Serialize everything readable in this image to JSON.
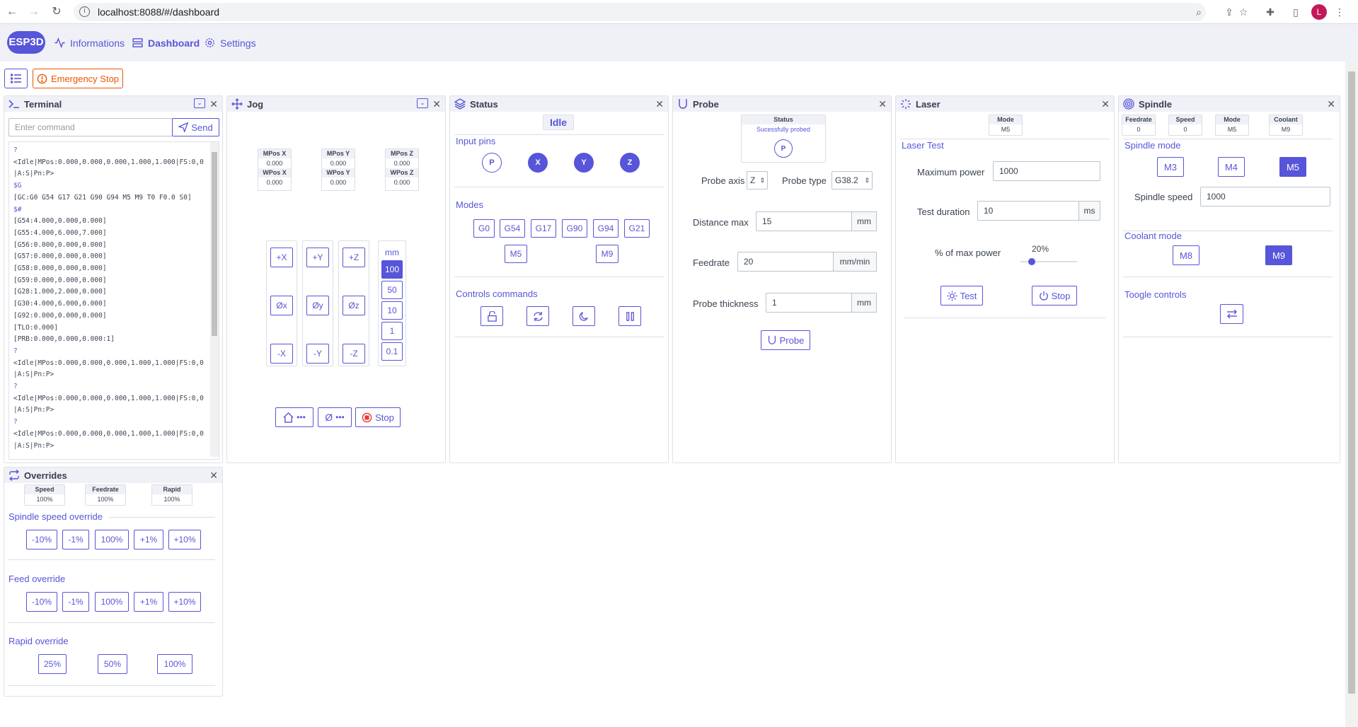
{
  "browser": {
    "url": "localhost:8088/#/dashboard",
    "avatar": "L"
  },
  "nav": {
    "logo": "ESP3D",
    "informations": "Informations",
    "dashboard": "Dashboard",
    "settings": "Settings"
  },
  "toolbar": {
    "emergency": "Emergency Stop"
  },
  "terminal": {
    "title": "Terminal",
    "placeholder": "Enter command",
    "send": "Send",
    "lines": [
      {
        "t": "?",
        "c": 1
      },
      {
        "t": "<Idle|MPos:0.000,0.000,0.000,1.000,1.000|FS:0,0|A:S|Pn:P>",
        "c": 0
      },
      {
        "t": "$G",
        "c": 1
      },
      {
        "t": "[GC:G0 G54 G17 G21 G90 G94 M5 M9 T0 F0.0 S0]",
        "c": 0
      },
      {
        "t": "$#",
        "c": 1
      },
      {
        "t": "[G54:4.000,0.000,0.000]",
        "c": 0
      },
      {
        "t": "[G55:4.000,6.000,7.000]",
        "c": 0
      },
      {
        "t": "[G56:0.000,0.000,0.000]",
        "c": 0
      },
      {
        "t": "[G57:0.000,0.000,0.000]",
        "c": 0
      },
      {
        "t": "[G58:0.000,0.000,0.000]",
        "c": 0
      },
      {
        "t": "[G59:0.000,0.000,0.000]",
        "c": 0
      },
      {
        "t": "[G28:1.000,2.000,0.000]",
        "c": 0
      },
      {
        "t": "[G30:4.000,6.000,0.000]",
        "c": 0
      },
      {
        "t": "[G92:0.000,0.000,0.000]",
        "c": 0
      },
      {
        "t": "[TLO:0.000]",
        "c": 0
      },
      {
        "t": "[PRB:0.000,0.000,0.000:1]",
        "c": 0
      },
      {
        "t": "?",
        "c": 1
      },
      {
        "t": "<Idle|MPos:0.000,0.000,0.000,1.000,1.000|FS:0,0|A:S|Pn:P>",
        "c": 0
      },
      {
        "t": "?",
        "c": 1
      },
      {
        "t": "<Idle|MPos:0.000,0.000,0.000,1.000,1.000|FS:0,0|A:S|Pn:P>",
        "c": 0
      },
      {
        "t": "?",
        "c": 1
      },
      {
        "t": "<Idle|MPos:0.000,0.000,0.000,1.000,1.000|FS:0,0|A:S|Pn:P>",
        "c": 0
      }
    ]
  },
  "jog": {
    "title": "Jog",
    "positions": [
      {
        "mlabel": "MPos X",
        "mval": "0.000",
        "wlabel": "WPos X",
        "wval": "0.000"
      },
      {
        "mlabel": "MPos Y",
        "mval": "0.000",
        "wlabel": "WPos Y",
        "wval": "0.000"
      },
      {
        "mlabel": "MPos Z",
        "mval": "0.000",
        "wlabel": "WPos Z",
        "wval": "0.000"
      }
    ],
    "plus": [
      "+X",
      "+Y",
      "+Z"
    ],
    "zero": [
      "Øx",
      "Øy",
      "Øz"
    ],
    "minus": [
      "-X",
      "-Y",
      "-Z"
    ],
    "unit": "mm",
    "steps": [
      "100",
      "50",
      "10",
      "1",
      "0.1"
    ],
    "home_dots": "•••",
    "zero_all": "Ø",
    "zero_dots": "•••",
    "stop": "Stop"
  },
  "status": {
    "title": "Status",
    "state": "Idle",
    "input_pins": "Input pins",
    "pins": [
      {
        "l": "P",
        "on": false
      },
      {
        "l": "X",
        "on": true
      },
      {
        "l": "Y",
        "on": true
      },
      {
        "l": "Z",
        "on": true
      }
    ],
    "modes_title": "Modes",
    "modes": [
      "G0",
      "G54",
      "G17",
      "G90",
      "G94",
      "G21"
    ],
    "modes2": [
      "M5",
      "M9"
    ],
    "controls": "Controls commands"
  },
  "probe": {
    "title": "Probe",
    "status_label": "Status",
    "status_value": "Sucessfully probed",
    "pin": "P",
    "axis_label": "Probe axis",
    "axis_value": "Z",
    "type_label": "Probe type",
    "type_value": "G38.2",
    "dist_label": "Distance max",
    "dist_value": "15",
    "dist_unit": "mm",
    "feed_label": "Feedrate",
    "feed_value": "20",
    "feed_unit": "mm/min",
    "thick_label": "Probe thickness",
    "thick_value": "1",
    "thick_unit": "mm",
    "button": "Probe"
  },
  "laser": {
    "title": "Laser",
    "mode_label": "Mode",
    "mode_value": "M5",
    "test_title": "Laser Test",
    "max_label": "Maximum power",
    "max_value": "1000",
    "dur_label": "Test duration",
    "dur_value": "10",
    "dur_unit": "ms",
    "pct_label": "% of max power",
    "pct_value": "20%",
    "pct_fraction": 0.2,
    "test": "Test",
    "stop": "Stop"
  },
  "spindle": {
    "title": "Spindle",
    "minis": [
      {
        "l": "Feedrate",
        "v": "0"
      },
      {
        "l": "Speed",
        "v": "0"
      },
      {
        "l": "Mode",
        "v": "M5"
      },
      {
        "l": "Coolant",
        "v": "M9"
      }
    ],
    "mode_title": "Spindle mode",
    "modes": [
      "M3",
      "M4",
      "M5"
    ],
    "active_mode": 2,
    "speed_label": "Spindle speed",
    "speed_value": "1000",
    "coolant_title": "Coolant mode",
    "coolant": [
      "M8",
      "M9"
    ],
    "active_coolant": 1,
    "toggle_title": "Toogle controls"
  },
  "overrides": {
    "title": "Overrides",
    "minis": [
      {
        "l": "Speed",
        "v": "100%"
      },
      {
        "l": "Feedrate",
        "v": "100%"
      },
      {
        "l": "Rapid",
        "v": "100%"
      }
    ],
    "spindle_title": "Spindle speed override",
    "feed_title": "Feed override",
    "rapid_title": "Rapid override",
    "steps": [
      "-10%",
      "-1%",
      "100%",
      "+1%",
      "+10%"
    ],
    "rapid": [
      "25%",
      "50%",
      "100%"
    ]
  },
  "colors": {
    "accent": "#5755d9",
    "emergency": "#e85600"
  }
}
